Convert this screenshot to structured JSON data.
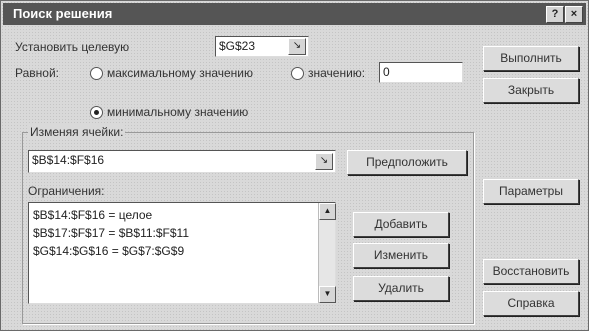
{
  "window": {
    "title": "Поиск решения"
  },
  "target": {
    "label": "Установить целевую",
    "value": "$G$23"
  },
  "equal_to": {
    "label": "Равной:",
    "max_label": "максимальному значению",
    "value_label": "значению:",
    "value_input": "0",
    "min_label": "минимальному значению",
    "selected": "min"
  },
  "changing": {
    "label": "Изменяя ячейки:",
    "value": "$B$14:$F$16",
    "guess_button": "Предположить"
  },
  "constraints": {
    "label": "Ограничения:",
    "items": [
      "$B$14:$F$16 = целое",
      "$B$17:$F$17 = $B$11:$F$11",
      "$G$14:$G$16 = $G$7:$G$9"
    ],
    "add_button": "Добавить",
    "change_button": "Изменить",
    "delete_button": "Удалить"
  },
  "buttons": {
    "solve": "Выполнить",
    "close": "Закрыть",
    "options": "Параметры",
    "reset": "Восстановить",
    "help": "Справка"
  },
  "titlebar_buttons": {
    "help": "?",
    "close": "×"
  }
}
